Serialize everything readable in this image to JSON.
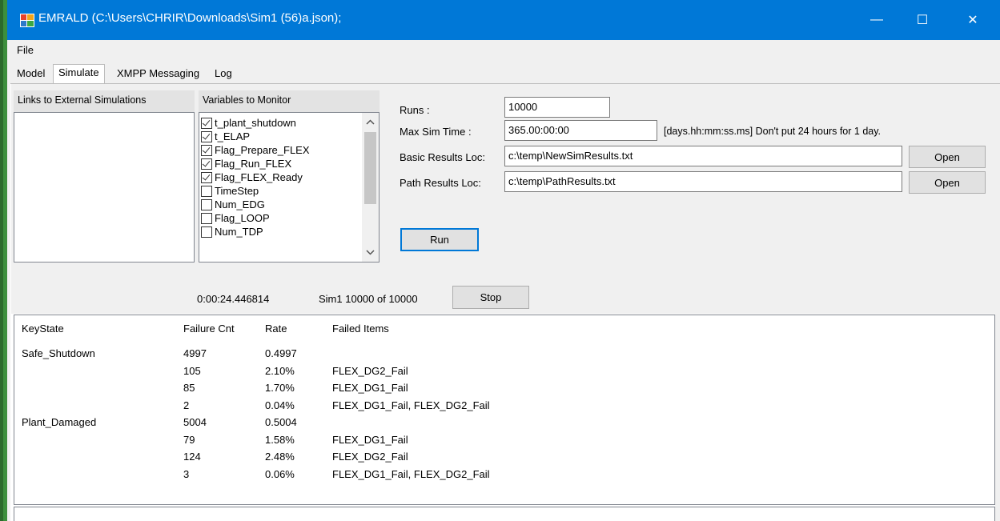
{
  "window": {
    "title": "EMRALD (C:\\Users\\CHRIR\\Downloads\\Sim1 (56)a.json);",
    "minimize_glyph": "—",
    "maximize_glyph": "☐",
    "close_glyph": "✕",
    "accent_color": "#0078d7"
  },
  "menu": {
    "file": "File"
  },
  "tabs": [
    {
      "label": "Model"
    },
    {
      "label": "Simulate"
    },
    {
      "label": "XMPP Messaging"
    },
    {
      "label": "Log"
    }
  ],
  "links_panel": {
    "header": "Links to External Simulations"
  },
  "variables_panel": {
    "header": "Variables to Monitor",
    "items": [
      {
        "label": "t_plant_shutdown",
        "checked": true
      },
      {
        "label": "t_ELAP",
        "checked": true
      },
      {
        "label": "Flag_Prepare_FLEX",
        "checked": true
      },
      {
        "label": "Flag_Run_FLEX",
        "checked": true
      },
      {
        "label": "Flag_FLEX_Ready",
        "checked": true
      },
      {
        "label": "TimeStep",
        "checked": false
      },
      {
        "label": "Num_EDG",
        "checked": false
      },
      {
        "label": "Flag_LOOP",
        "checked": false
      },
      {
        "label": "Num_TDP",
        "checked": false
      }
    ]
  },
  "settings": {
    "runs_label": "Runs :",
    "runs_value": "10000",
    "max_sim_time_label": "Max Sim Time :",
    "max_sim_time_value": "365.00:00:00",
    "time_format_hint": "[days.hh:mm:ss.ms]  Don't put 24 hours for 1 day.",
    "basic_results_label": "Basic Results Loc:",
    "basic_results_value": "c:\\temp\\NewSimResults.txt",
    "path_results_label": "Path Results Loc:",
    "path_results_value": "c:\\temp\\PathResults.txt",
    "open_label": "Open",
    "run_label": "Run"
  },
  "status": {
    "elapsed": "0:00:24.446814",
    "progress_text": "Sim1 10000 of 10000",
    "stop_label": "Stop"
  },
  "results": {
    "columns": [
      "KeyState",
      "Failure Cnt",
      "Rate",
      "Failed Items"
    ],
    "rows": [
      {
        "keystate": "Safe_Shutdown",
        "count": "4997",
        "rate": "0.4997",
        "items": ""
      },
      {
        "keystate": "",
        "count": "105",
        "rate": "2.10%",
        "items": "FLEX_DG2_Fail"
      },
      {
        "keystate": "",
        "count": "85",
        "rate": "1.70%",
        "items": "FLEX_DG1_Fail"
      },
      {
        "keystate": "",
        "count": "2",
        "rate": "0.04%",
        "items": "FLEX_DG1_Fail, FLEX_DG2_Fail"
      },
      {
        "keystate": "Plant_Damaged",
        "count": "5004",
        "rate": "0.5004",
        "items": ""
      },
      {
        "keystate": "",
        "count": "79",
        "rate": "1.58%",
        "items": "FLEX_DG1_Fail"
      },
      {
        "keystate": "",
        "count": "124",
        "rate": "2.48%",
        "items": "FLEX_DG2_Fail"
      },
      {
        "keystate": "",
        "count": "3",
        "rate": "0.06%",
        "items": "FLEX_DG1_Fail, FLEX_DG2_Fail"
      }
    ]
  }
}
